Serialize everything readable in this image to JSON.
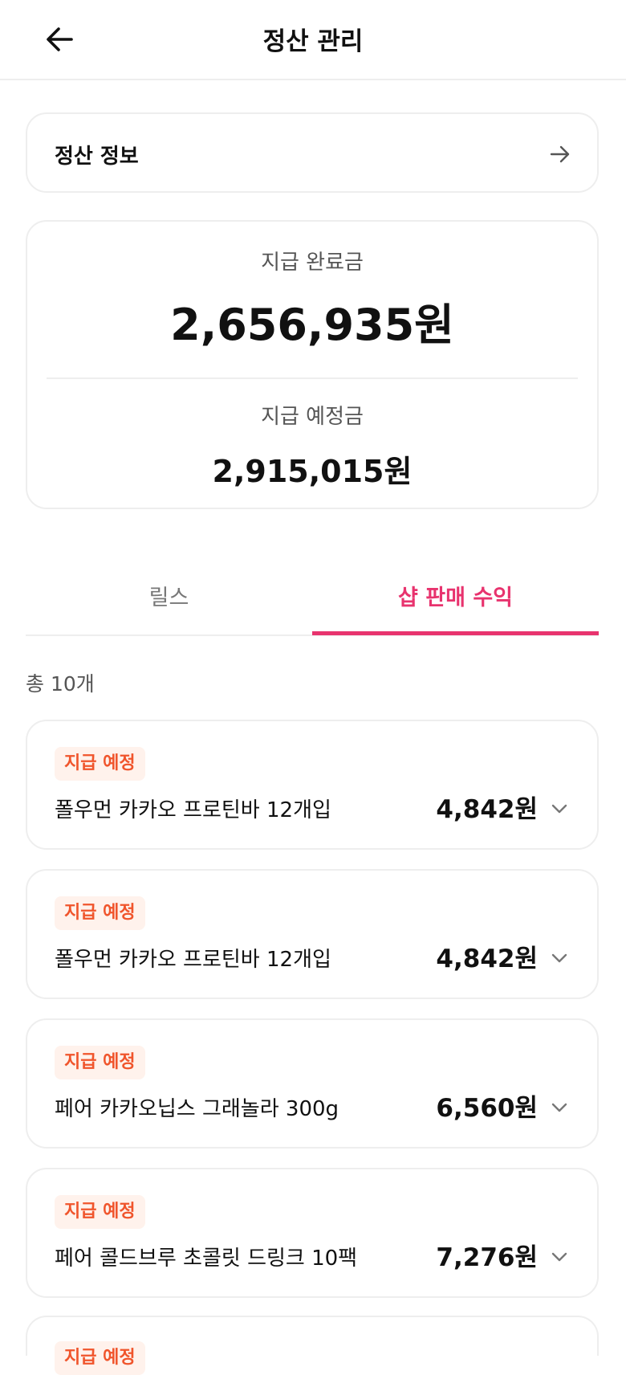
{
  "header": {
    "title": "정산 관리"
  },
  "settlement_info": {
    "label": "정산 정보"
  },
  "summary": {
    "paid_label": "지급 완료금",
    "paid_value": "2,656,935원",
    "scheduled_label": "지급 예정금",
    "scheduled_value": "2,915,015원"
  },
  "tabs": [
    {
      "label": "릴스",
      "active": false
    },
    {
      "label": "샵 판매 수익",
      "active": true
    }
  ],
  "list": {
    "count_label": "총 10개",
    "items": [
      {
        "status": "지급 예정",
        "name": "폴우먼 카카오 프로틴바 12개입",
        "amount": "4,842원"
      },
      {
        "status": "지급 예정",
        "name": "폴우먼 카카오 프로틴바 12개입",
        "amount": "4,842원"
      },
      {
        "status": "지급 예정",
        "name": "페어 카카오닙스 그래놀라 300g",
        "amount": "6,560원"
      },
      {
        "status": "지급 예정",
        "name": "페어 콜드브루 초콜릿 드링크 10팩",
        "amount": "7,276원"
      },
      {
        "status": "지급 예정",
        "name": "",
        "amount": ""
      }
    ]
  },
  "colors": {
    "accent": "#e8336e",
    "badge_text": "#f0552c",
    "badge_bg": "#fff2ec"
  }
}
